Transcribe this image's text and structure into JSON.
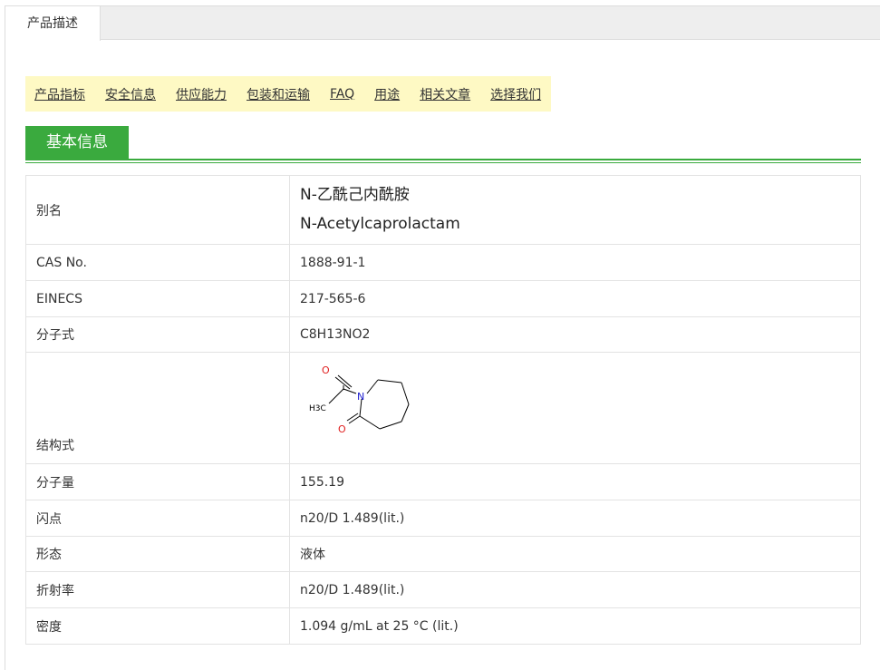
{
  "tabs": [
    {
      "label": "产品描述"
    }
  ],
  "nav": {
    "links": [
      "产品指标",
      "安全信息",
      "供应能力",
      "包装和运输",
      "FAQ",
      "用途",
      "相关文章",
      "选择我们"
    ]
  },
  "section": {
    "title": "基本信息"
  },
  "rows": [
    {
      "key": "别名",
      "values": [
        "N-乙酰己内酰胺",
        "N-Acetylcaprolactam"
      ]
    },
    {
      "key": "CAS No.",
      "value": "1888-91-1"
    },
    {
      "key": "EINECS",
      "value": "217-565-6"
    },
    {
      "key": "分子式",
      "value": "C8H13NO2"
    },
    {
      "key": "结构式",
      "structure": {
        "atoms": [
          "O",
          "N",
          "H3C",
          "O"
        ]
      }
    },
    {
      "key": "分子量",
      "value": "155.19"
    },
    {
      "key": "闪点",
      "value": "n20/D 1.489(lit.)"
    },
    {
      "key": "形态",
      "value": "液体"
    },
    {
      "key": "折射率",
      "value": "n20/D 1.489(lit.)"
    },
    {
      "key": "密度",
      "value": "1.094 g/mL at 25 °C (lit.)"
    }
  ],
  "colors": {
    "accent_green": "#3aaa3e",
    "nav_bg": "#fef9c4",
    "oxygen": "#e02020",
    "nitrogen": "#2020d0"
  }
}
